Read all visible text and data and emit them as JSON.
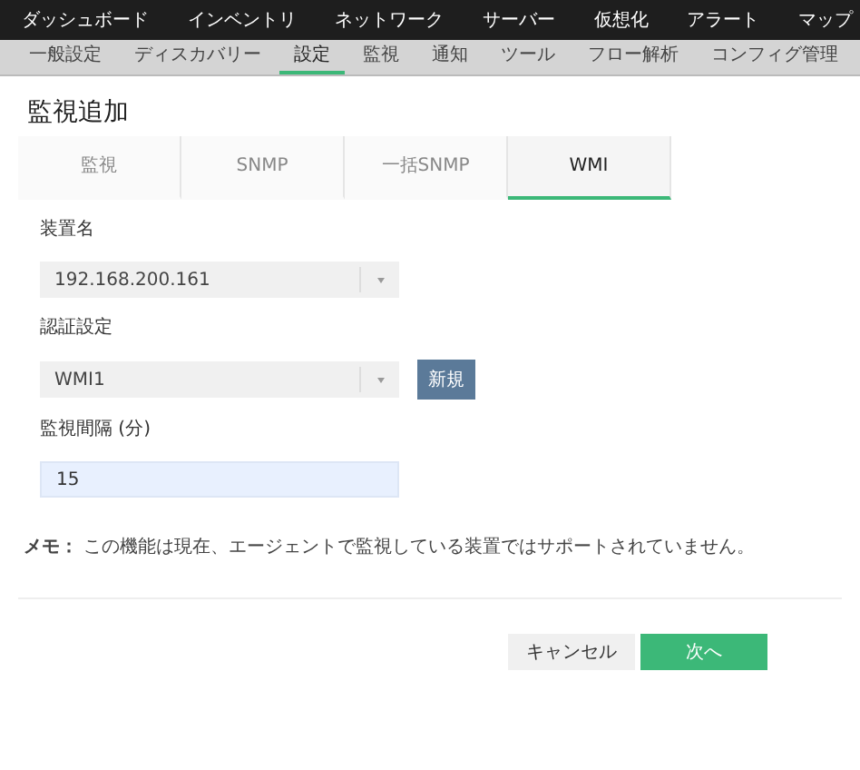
{
  "main_nav": [
    "ダッシュボード",
    "インベントリ",
    "ネットワーク",
    "サーバー",
    "仮想化",
    "アラート",
    "マップ"
  ],
  "sub_nav": [
    {
      "label": "一般設定",
      "selected": false
    },
    {
      "label": "ディスカバリー",
      "selected": false
    },
    {
      "label": "設定",
      "selected": true
    },
    {
      "label": "監視",
      "selected": false
    },
    {
      "label": "通知",
      "selected": false
    },
    {
      "label": "ツール",
      "selected": false
    },
    {
      "label": "フロー解析",
      "selected": false
    },
    {
      "label": "コンフィグ管理",
      "selected": false
    }
  ],
  "title": "監視追加",
  "tabs": [
    {
      "label": "監視",
      "selected": false
    },
    {
      "label": "SNMP",
      "selected": false
    },
    {
      "label": "一括SNMP",
      "selected": false
    },
    {
      "label": "WMI",
      "selected": true
    }
  ],
  "fields": [
    {
      "kind": "select",
      "label": "装置名",
      "value": "192.168.200.161"
    },
    {
      "kind": "select",
      "label": "認証設定",
      "value": "WMI1",
      "button": "新規"
    },
    {
      "kind": "input",
      "label": "監視間隔 (分)",
      "value": "15"
    }
  ],
  "note": "**メモ：** この機能は現在、エージェントで監視している装置ではサポートされていません。",
  "buttons": [
    {
      "kind": "secondary",
      "label": "キャンセル"
    },
    {
      "kind": "primary",
      "label": "次へ"
    }
  ]
}
